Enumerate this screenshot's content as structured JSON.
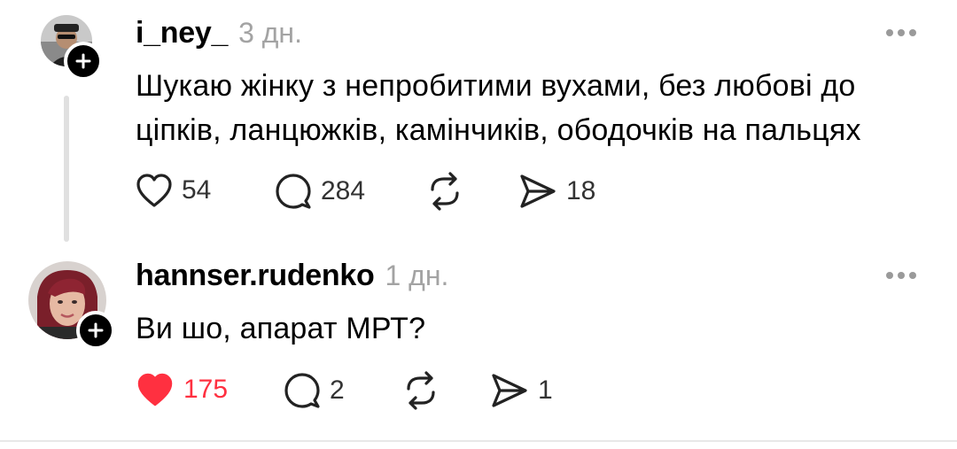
{
  "posts": [
    {
      "username": "i_ney_",
      "time": "3 дн.",
      "text_lines": [
        "Шукаю жінку з непробитими вухами, без любові до",
        "ціпків, ланцюжків, камінчиків, ободочків на пальцях"
      ],
      "likes": "54",
      "comments": "284",
      "shares": "18",
      "liked": false
    },
    {
      "username": "hannser.rudenko",
      "time": "1 дн.",
      "text_lines": [
        "Ви шо, апарат МРТ?"
      ],
      "likes": "175",
      "comments": "2",
      "shares": "1",
      "liked": true
    }
  ],
  "colors": {
    "liked": "#ff3040",
    "muted": "#a3a3a3",
    "thread_line": "#e0e0e0"
  },
  "icons": [
    "heart-icon",
    "comment-icon",
    "repost-icon",
    "share-icon",
    "more-icon",
    "plus-icon"
  ]
}
